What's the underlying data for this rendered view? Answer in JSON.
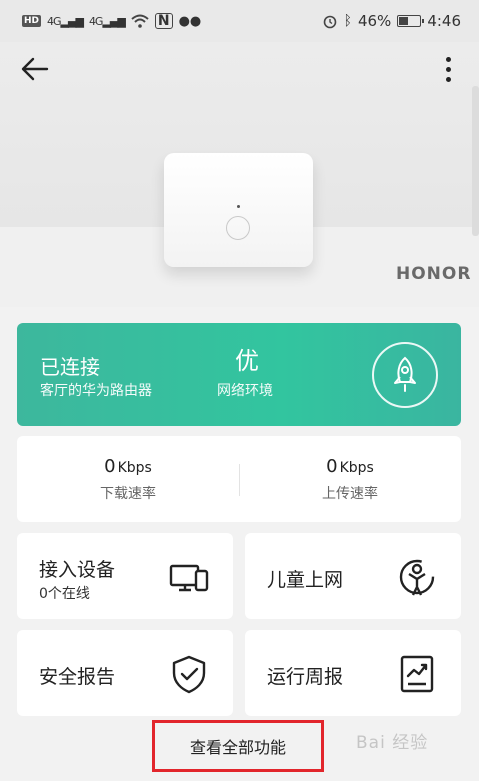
{
  "status_bar": {
    "network_badge": "HD",
    "network_type_1": "4G",
    "network_type_2": "4G",
    "battery_percent": "46%",
    "battery_level": 0.46,
    "time": "4:46"
  },
  "hero": {
    "brand": "HONOR"
  },
  "status_card": {
    "title": "已连接",
    "subtitle": "客厅的华为路由器",
    "quality": "优",
    "quality_label": "网络环境",
    "accent": "#35c09e"
  },
  "speed": {
    "download_value": "0",
    "download_unit": "Kbps",
    "download_label": "下载速率",
    "upload_value": "0",
    "upload_unit": "Kbps",
    "upload_label": "上传速率"
  },
  "tiles": {
    "devices": {
      "label": "接入设备",
      "sub": "0个在线",
      "icon": "devices-icon"
    },
    "kids": {
      "label": "儿童上网",
      "icon": "child-icon"
    },
    "security": {
      "label": "安全报告",
      "icon": "shield-check-icon"
    },
    "weekly": {
      "label": "运行周报",
      "icon": "report-chart-icon"
    }
  },
  "bottom": {
    "all_features_label": "查看全部功能",
    "highlight_color": "#e2262c"
  },
  "watermark": {
    "text": "Bai 经验"
  }
}
